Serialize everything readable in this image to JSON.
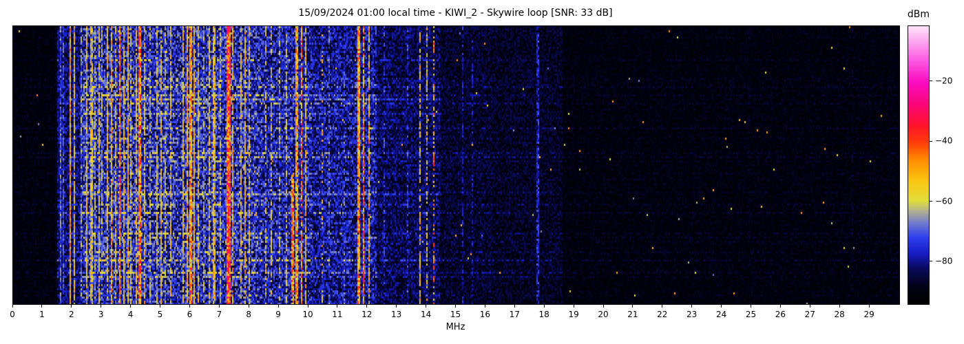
{
  "title": "15/09/2024 01:00 local time - KIWI_2 - Skywire loop [SNR: 33 dB]",
  "x_axis": {
    "label": "MHz",
    "range": [
      0,
      30
    ],
    "tick_labels": [
      0,
      1,
      2,
      3,
      4,
      5,
      6,
      7,
      8,
      9,
      10,
      11,
      12,
      13,
      14,
      15,
      16,
      17,
      18,
      19,
      20,
      21,
      22,
      23,
      24,
      25,
      26,
      27,
      28,
      29
    ]
  },
  "colorbar": {
    "label": "dBm",
    "ticks": [
      -20,
      -40,
      -60,
      -80
    ],
    "vmax": -1.5,
    "vmin": -94
  },
  "chart_data": {
    "type": "heatmap",
    "subtype": "radio-spectrogram-waterfall",
    "title": "15/09/2024 01:00 local time - KIWI_2 - Skywire loop [SNR: 33 dB]",
    "xlabel": "MHz",
    "x_range_mhz": [
      0,
      30
    ],
    "color_scale": {
      "unit": "dBm",
      "min": -94,
      "max": -1.5,
      "tick_values": [
        -20,
        -40,
        -60,
        -80
      ]
    },
    "colormap_stops": [
      [
        0.0,
        0,
        0,
        0
      ],
      [
        0.06,
        2,
        2,
        20
      ],
      [
        0.13,
        10,
        10,
        95
      ],
      [
        0.18,
        22,
        28,
        195
      ],
      [
        0.24,
        48,
        64,
        240
      ],
      [
        0.29,
        112,
        122,
        205
      ],
      [
        0.33,
        172,
        172,
        152
      ],
      [
        0.37,
        224,
        222,
        60
      ],
      [
        0.44,
        250,
        200,
        20
      ],
      [
        0.52,
        255,
        140,
        0
      ],
      [
        0.58,
        255,
        62,
        10
      ],
      [
        0.64,
        255,
        20,
        42
      ],
      [
        0.72,
        250,
        6,
        122
      ],
      [
        0.8,
        250,
        12,
        192
      ],
      [
        0.88,
        252,
        92,
        226
      ],
      [
        1.0,
        255,
        228,
        250
      ]
    ],
    "noise_floor_regions": [
      {
        "f0": 0.0,
        "f1": 1.5,
        "base": 0.05
      },
      {
        "f0": 1.5,
        "f1": 2.35,
        "base": 0.14
      },
      {
        "f0": 2.35,
        "f1": 8.45,
        "base": 0.21
      },
      {
        "f0": 8.45,
        "f1": 10.1,
        "base": 0.19
      },
      {
        "f0": 10.1,
        "f1": 11.55,
        "base": 0.17
      },
      {
        "f0": 11.55,
        "f1": 12.3,
        "base": 0.18
      },
      {
        "f0": 12.3,
        "f1": 14.45,
        "base": 0.12
      },
      {
        "f0": 14.45,
        "f1": 16.2,
        "base": 0.09
      },
      {
        "f0": 16.2,
        "f1": 18.6,
        "base": 0.08
      },
      {
        "f0": 18.6,
        "f1": 30.0,
        "base": 0.05
      }
    ],
    "signal_lines": [
      {
        "f": 1.62,
        "w": 0.05,
        "v": 0.3,
        "d": 0.9
      },
      {
        "f": 1.72,
        "w": 0.04,
        "v": 0.27,
        "d": 0.8
      },
      {
        "f": 1.92,
        "w": 0.05,
        "v": 0.5,
        "d": 1.0
      },
      {
        "f": 2.06,
        "w": 0.04,
        "v": 0.44,
        "d": 0.9
      },
      {
        "f": 2.32,
        "w": 0.04,
        "v": 0.34,
        "d": 0.8
      },
      {
        "f": 2.5,
        "w": 0.05,
        "v": 0.44,
        "d": 0.95
      },
      {
        "f": 2.65,
        "w": 0.06,
        "v": 0.42,
        "d": 0.9
      },
      {
        "f": 2.78,
        "w": 0.05,
        "v": 0.38,
        "d": 0.8
      },
      {
        "f": 2.9,
        "w": 0.05,
        "v": 0.44,
        "d": 0.9
      },
      {
        "f": 3.02,
        "w": 0.04,
        "v": 0.36,
        "d": 0.8
      },
      {
        "f": 3.2,
        "w": 0.05,
        "v": 0.46,
        "d": 0.9
      },
      {
        "f": 3.33,
        "w": 0.06,
        "v": 0.52,
        "d": 0.9
      },
      {
        "f": 3.48,
        "w": 0.05,
        "v": 0.42,
        "d": 0.85
      },
      {
        "f": 3.62,
        "w": 0.07,
        "v": 0.58,
        "d": 0.95
      },
      {
        "f": 3.75,
        "w": 0.05,
        "v": 0.45,
        "d": 0.9
      },
      {
        "f": 3.88,
        "w": 0.06,
        "v": 0.48,
        "d": 0.9
      },
      {
        "f": 4.0,
        "w": 0.05,
        "v": 0.42,
        "d": 0.85
      },
      {
        "f": 4.15,
        "w": 0.05,
        "v": 0.44,
        "d": 0.85
      },
      {
        "f": 4.3,
        "w": 0.09,
        "v": 0.6,
        "d": 0.95
      },
      {
        "f": 4.45,
        "w": 0.05,
        "v": 0.46,
        "d": 0.85
      },
      {
        "f": 4.65,
        "w": 0.04,
        "v": 0.38,
        "d": 0.7
      },
      {
        "f": 4.85,
        "w": 0.05,
        "v": 0.42,
        "d": 0.8
      },
      {
        "f": 5.0,
        "w": 0.05,
        "v": 0.46,
        "d": 0.85
      },
      {
        "f": 5.15,
        "w": 0.04,
        "v": 0.38,
        "d": 0.7
      },
      {
        "f": 5.35,
        "w": 0.05,
        "v": 0.44,
        "d": 0.8
      },
      {
        "f": 5.5,
        "w": 0.04,
        "v": 0.4,
        "d": 0.75
      },
      {
        "f": 5.75,
        "w": 0.05,
        "v": 0.46,
        "d": 0.85
      },
      {
        "f": 5.9,
        "w": 0.07,
        "v": 0.5,
        "d": 0.9
      },
      {
        "f": 6.0,
        "w": 0.08,
        "v": 0.54,
        "d": 0.95
      },
      {
        "f": 6.12,
        "w": 0.06,
        "v": 0.5,
        "d": 0.9
      },
      {
        "f": 6.25,
        "w": 0.05,
        "v": 0.44,
        "d": 0.85
      },
      {
        "f": 6.45,
        "w": 0.04,
        "v": 0.36,
        "d": 0.7
      },
      {
        "f": 6.65,
        "w": 0.05,
        "v": 0.42,
        "d": 0.8
      },
      {
        "f": 6.8,
        "w": 0.05,
        "v": 0.46,
        "d": 0.85
      },
      {
        "f": 7.0,
        "w": 0.04,
        "v": 0.4,
        "d": 0.8
      },
      {
        "f": 7.3,
        "w": 0.14,
        "v": 0.66,
        "d": 1.0
      },
      {
        "f": 7.45,
        "w": 0.05,
        "v": 0.5,
        "d": 0.85
      },
      {
        "f": 7.7,
        "w": 0.05,
        "v": 0.44,
        "d": 0.8
      },
      {
        "f": 7.85,
        "w": 0.06,
        "v": 0.48,
        "d": 0.85
      },
      {
        "f": 8.0,
        "w": 0.05,
        "v": 0.44,
        "d": 0.8
      },
      {
        "f": 8.15,
        "w": 0.04,
        "v": 0.38,
        "d": 0.7
      },
      {
        "f": 8.55,
        "w": 0.04,
        "v": 0.42,
        "d": 0.6
      },
      {
        "f": 8.75,
        "w": 0.04,
        "v": 0.4,
        "d": 0.6
      },
      {
        "f": 9.0,
        "w": 0.04,
        "v": 0.38,
        "d": 0.6
      },
      {
        "f": 9.25,
        "w": 0.04,
        "v": 0.4,
        "d": 0.7
      },
      {
        "f": 9.45,
        "w": 0.06,
        "v": 0.58,
        "d": 0.85,
        "half": "lower"
      },
      {
        "f": 9.6,
        "w": 0.08,
        "v": 0.52,
        "d": 0.9
      },
      {
        "f": 9.75,
        "w": 0.06,
        "v": 0.58,
        "d": 0.85
      },
      {
        "f": 9.9,
        "w": 0.05,
        "v": 0.46,
        "d": 0.85
      },
      {
        "f": 10.45,
        "w": 0.04,
        "v": 0.5,
        "d": 0.35
      },
      {
        "f": 10.7,
        "w": 0.03,
        "v": 0.3,
        "d": 0.5
      },
      {
        "f": 11.2,
        "w": 0.03,
        "v": 0.3,
        "d": 0.5
      },
      {
        "f": 11.7,
        "w": 0.1,
        "v": 0.55,
        "d": 0.95
      },
      {
        "f": 11.85,
        "w": 0.06,
        "v": 0.6,
        "d": 0.9
      },
      {
        "f": 12.05,
        "w": 0.05,
        "v": 0.5,
        "d": 0.85
      },
      {
        "f": 12.55,
        "w": 0.03,
        "v": 0.26,
        "d": 0.5
      },
      {
        "f": 12.9,
        "w": 0.03,
        "v": 0.36,
        "d": 0.3
      },
      {
        "f": 13.35,
        "w": 0.03,
        "v": 0.26,
        "d": 0.4
      },
      {
        "f": 13.6,
        "w": 0.04,
        "v": 0.44,
        "d": 0.75
      },
      {
        "f": 13.78,
        "w": 0.04,
        "v": 0.46,
        "d": 0.75
      },
      {
        "f": 14.0,
        "w": 0.04,
        "v": 0.42,
        "d": 0.6
      },
      {
        "f": 14.22,
        "w": 0.06,
        "v": 0.55,
        "d": 0.5
      },
      {
        "f": 15.2,
        "w": 0.03,
        "v": 0.22,
        "d": 0.6
      },
      {
        "f": 15.55,
        "w": 0.03,
        "v": 0.2,
        "d": 0.5
      },
      {
        "f": 16.3,
        "w": 0.03,
        "v": 0.18,
        "d": 0.4
      },
      {
        "f": 17.75,
        "w": 0.05,
        "v": 0.24,
        "d": 0.7
      },
      {
        "f": 18.3,
        "w": 0.03,
        "v": 0.2,
        "d": 0.5
      },
      {
        "f": 21.1,
        "w": 0.02,
        "v": 0.12,
        "d": 0.3
      },
      {
        "f": 24.9,
        "w": 0.02,
        "v": 0.1,
        "d": 0.3
      },
      {
        "f": 28.4,
        "w": 0.02,
        "v": 0.12,
        "d": 0.3
      }
    ],
    "horizontal_streaks": [
      {
        "row_frac": 0.26,
        "f0": 1.9,
        "f1": 14.5,
        "boost": 0.08
      },
      {
        "row_frac": 0.31,
        "f0": 1.9,
        "f1": 14.5,
        "boost": 0.07
      },
      {
        "row_frac": 0.6,
        "f0": 1.9,
        "f1": 14.5,
        "boost": 0.07
      }
    ],
    "legend_position": "right-colorbar",
    "grid": false
  }
}
